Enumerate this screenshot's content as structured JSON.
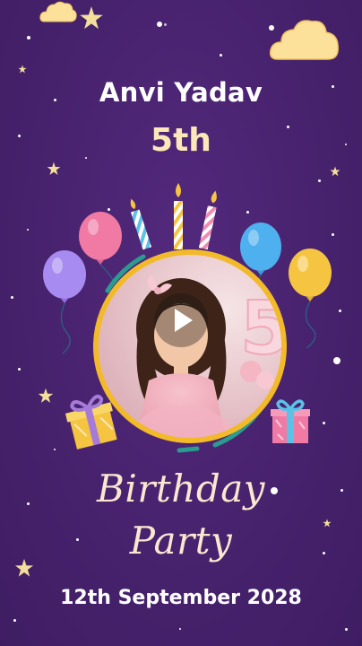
{
  "invite": {
    "name": "Anvi Yadav",
    "age": "5th",
    "title_line1": "Birthday",
    "title_line2": "Party",
    "date": "12th September 2028"
  },
  "colors": {
    "background": "#47226d",
    "frame": "#f2b928",
    "title_text": "#ffffff",
    "age_text": "#fbe7b8",
    "script_text": "#fbe7d0"
  },
  "icons": {
    "play": "play-icon",
    "balloons": [
      "purple-balloon-icon",
      "pink-balloon-icon",
      "blue-balloon-icon",
      "yellow-balloon-icon"
    ],
    "candles": "candles-icon",
    "gifts": [
      "yellow-gift-icon",
      "pink-gift-icon"
    ],
    "clouds": "cloud-icon",
    "stars": "star-icon"
  }
}
